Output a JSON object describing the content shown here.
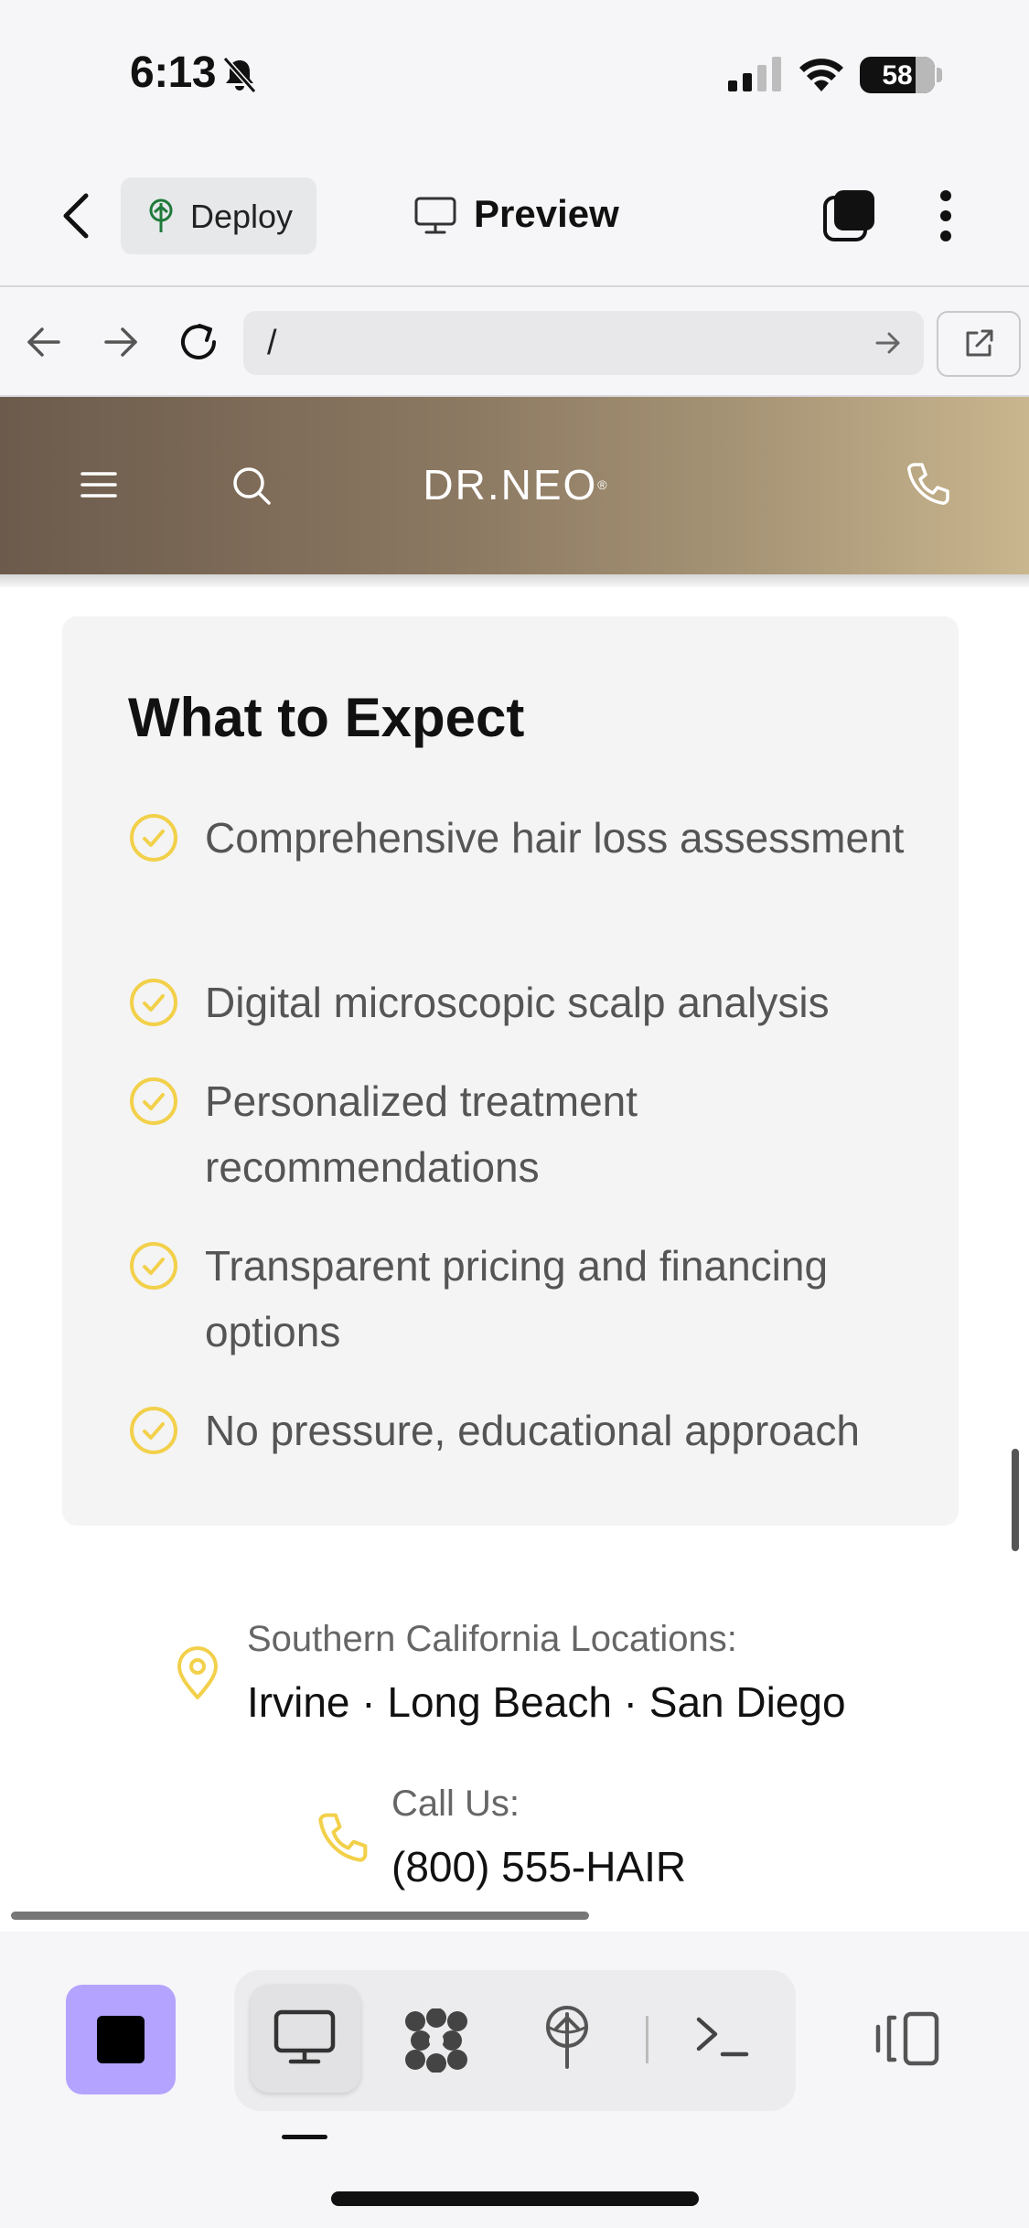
{
  "status_bar": {
    "time": "6:13",
    "battery": "58",
    "icons": [
      "bell-slash-icon",
      "signal-icon",
      "wifi-icon",
      "battery-icon"
    ]
  },
  "app_header": {
    "back_icon": "chevron-left-icon",
    "deploy_label": "Deploy",
    "preview_label": "Preview",
    "icons": [
      "deploy-tree-icon",
      "monitor-icon",
      "tabs-icon",
      "kebab-menu-icon"
    ]
  },
  "address_bar": {
    "url": "/",
    "icons": [
      "arrow-left-icon",
      "arrow-right-icon",
      "reload-icon",
      "go-arrow-icon",
      "open-external-icon"
    ]
  },
  "site": {
    "logo": "DR.NEO",
    "logo_mark": "®",
    "icons": [
      "hamburger-icon",
      "search-icon",
      "phone-icon"
    ],
    "accent_color": "#f2d04a"
  },
  "expect_card": {
    "title": "What to Expect",
    "items": [
      "Comprehensive hair loss assessment",
      "Digital microscopic scalp analysis",
      "Personalized treatment recommendations",
      "Transparent pricing and financing options",
      "No pressure, educational approach"
    ]
  },
  "locations": {
    "label": "Southern California Locations:",
    "value": "Irvine · Long Beach · San Diego"
  },
  "call": {
    "label": "Call Us:",
    "value": "(800) 555-HAIR"
  },
  "bottom_toolbar": {
    "icons": [
      "stop-icon",
      "monitor-icon",
      "cluster-icon",
      "deploy-icon",
      "terminal-icon",
      "split-view-icon"
    ],
    "stop_color": "#b4a4ff"
  }
}
